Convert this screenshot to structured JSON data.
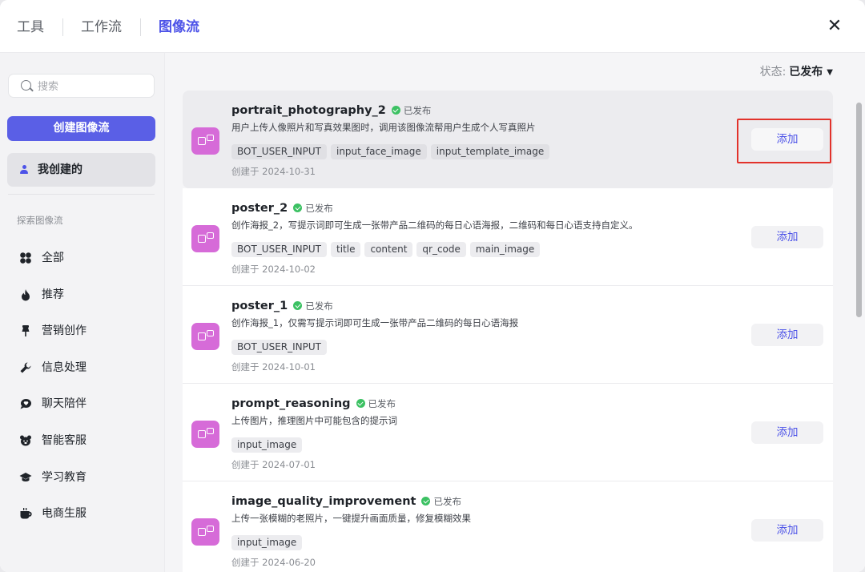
{
  "tabs": [
    {
      "label": "工具"
    },
    {
      "label": "工作流"
    },
    {
      "label": "图像流"
    }
  ],
  "icons": {
    "close": "close-icon",
    "search": "search-icon",
    "user": "user-icon",
    "app": "imageflow-icon"
  },
  "sidebar": {
    "search_placeholder": "搜索",
    "create_label": "创建图像流",
    "mine_label": "我创建的",
    "explore_label": "探索图像流",
    "categories": [
      {
        "label": "全部",
        "icon": "grid-icon"
      },
      {
        "label": "推荐",
        "icon": "fire-icon"
      },
      {
        "label": "营销创作",
        "icon": "pin-icon"
      },
      {
        "label": "信息处理",
        "icon": "wrench-icon"
      },
      {
        "label": "聊天陪伴",
        "icon": "chat-heart-icon"
      },
      {
        "label": "智能客服",
        "icon": "bear-icon"
      },
      {
        "label": "学习教育",
        "icon": "graduation-cap-icon"
      },
      {
        "label": "电商生服",
        "icon": "coffee-cup-icon"
      }
    ]
  },
  "status": {
    "label": "状态:",
    "value": "已发布"
  },
  "items": [
    {
      "title": "portrait_photography_2",
      "badge": "已发布",
      "desc": "用户上传人像照片和写真效果图时，调用该图像流帮用户生成个人写真照片",
      "tags": [
        "BOT_USER_INPUT",
        "input_face_image",
        "input_template_image"
      ],
      "date": "创建于 2024-10-31",
      "add_label": "添加"
    },
    {
      "title": "poster_2",
      "badge": "已发布",
      "desc": "创作海报_2，写提示词即可生成一张带产品二维码的每日心语海报，二维码和每日心语支持自定义。",
      "tags": [
        "BOT_USER_INPUT",
        "title",
        "content",
        "qr_code",
        "main_image"
      ],
      "date": "创建于 2024-10-02",
      "add_label": "添加"
    },
    {
      "title": "poster_1",
      "badge": "已发布",
      "desc": "创作海报_1，仅需写提示词即可生成一张带产品二维码的每日心语海报",
      "tags": [
        "BOT_USER_INPUT"
      ],
      "date": "创建于 2024-10-01",
      "add_label": "添加"
    },
    {
      "title": "prompt_reasoning",
      "badge": "已发布",
      "desc": "上传图片，推理图片中可能包含的提示词",
      "tags": [
        "input_image"
      ],
      "date": "创建于 2024-07-01",
      "add_label": "添加"
    },
    {
      "title": "image_quality_improvement",
      "badge": "已发布",
      "desc": "上传一张模糊的老照片，一键提升画面质量，修复模糊效果",
      "tags": [
        "input_image"
      ],
      "date": "创建于 2024-06-20",
      "add_label": "添加"
    }
  ]
}
